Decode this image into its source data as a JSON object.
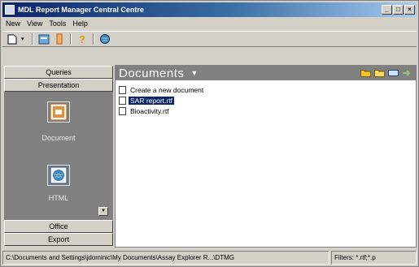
{
  "window": {
    "title": "MDL Report Manager Central Centre",
    "controls": [
      "_",
      "□",
      "×"
    ]
  },
  "menu": [
    "New",
    "View",
    "Tools",
    "Help"
  ],
  "toolbar": {
    "buttons": [
      "new-document-icon",
      "dropdown-arrow",
      "report-icon",
      "script-icon",
      "help-icon",
      "globe-icon"
    ]
  },
  "sidebar": {
    "groups": [
      "Queries",
      "Presentation",
      "Office",
      "Export"
    ],
    "items": [
      {
        "label": "Document",
        "icon": "document-icon"
      },
      {
        "label": "HTML",
        "icon": "html-icon"
      }
    ],
    "scroll_down": "▼"
  },
  "main": {
    "title": "Documents",
    "chevron": "▼",
    "header_tools": [
      "folder-icon",
      "open-folder-icon",
      "view-icon",
      "arrow-right-icon"
    ],
    "files": [
      {
        "label": "Create a new document",
        "selected": false
      },
      {
        "label": "SAR report.rtf",
        "selected": true
      },
      {
        "label": "Bioactivity.rtf",
        "selected": false
      }
    ]
  },
  "status": {
    "path": "C:\\Documents and Settings\\jdominic\\My Documents\\Assay Explorer R...\\DTMG",
    "filter": "Filters: *.rtf;*.p"
  },
  "colors": {
    "title_gradient_start": "#0a246a",
    "title_gradient_end": "#a6caf0",
    "selection": "#0a246a",
    "sidebar_panel": "#808080"
  }
}
